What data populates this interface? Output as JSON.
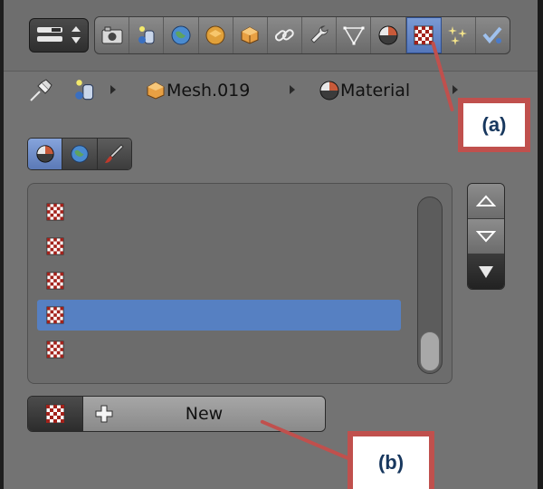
{
  "header": {
    "editor_type_icon": "editor-type-icon",
    "tabs": [
      {
        "name": "render",
        "icon": "camera-icon",
        "active": false
      },
      {
        "name": "render-layers",
        "icon": "render-layers-icon",
        "active": false
      },
      {
        "name": "scene",
        "icon": "scene-icon",
        "active": false
      },
      {
        "name": "world",
        "icon": "world-icon",
        "active": false
      },
      {
        "name": "object",
        "icon": "cube-icon",
        "active": false
      },
      {
        "name": "constraints",
        "icon": "chain-link-icon",
        "active": false
      },
      {
        "name": "modifiers",
        "icon": "wrench-icon",
        "active": false
      },
      {
        "name": "data",
        "icon": "mesh-data-icon",
        "active": false
      },
      {
        "name": "material",
        "icon": "material-sphere-icon",
        "active": false
      },
      {
        "name": "texture",
        "icon": "checker-texture-icon",
        "active": true
      },
      {
        "name": "particles",
        "icon": "particles-icon",
        "active": false
      },
      {
        "name": "physics",
        "icon": "physics-icon",
        "active": false
      }
    ]
  },
  "breadcrumb": {
    "mesh_label": "Mesh.019",
    "material_label": "Material"
  },
  "material_tabs": [
    {
      "icon": "material-sphere-icon",
      "active": true
    },
    {
      "icon": "world-icon",
      "active": false
    },
    {
      "icon": "brush-icon",
      "active": false
    }
  ],
  "texture_slots": {
    "rows": [
      {
        "icon": "checker-texture-icon",
        "selected": false
      },
      {
        "icon": "checker-texture-icon",
        "selected": false
      },
      {
        "icon": "checker-texture-icon",
        "selected": false
      },
      {
        "icon": "checker-texture-icon",
        "selected": true
      },
      {
        "icon": "checker-texture-icon",
        "selected": false
      }
    ]
  },
  "new_button": {
    "label": "New"
  },
  "annotations": {
    "a_label": "(a)",
    "b_label": "(b)",
    "color": "#c0504d",
    "text_color": "#17375e"
  },
  "colors": {
    "panel_bg": "#737373",
    "selection": "#5680c2",
    "active_tab": "#5b79b6"
  }
}
